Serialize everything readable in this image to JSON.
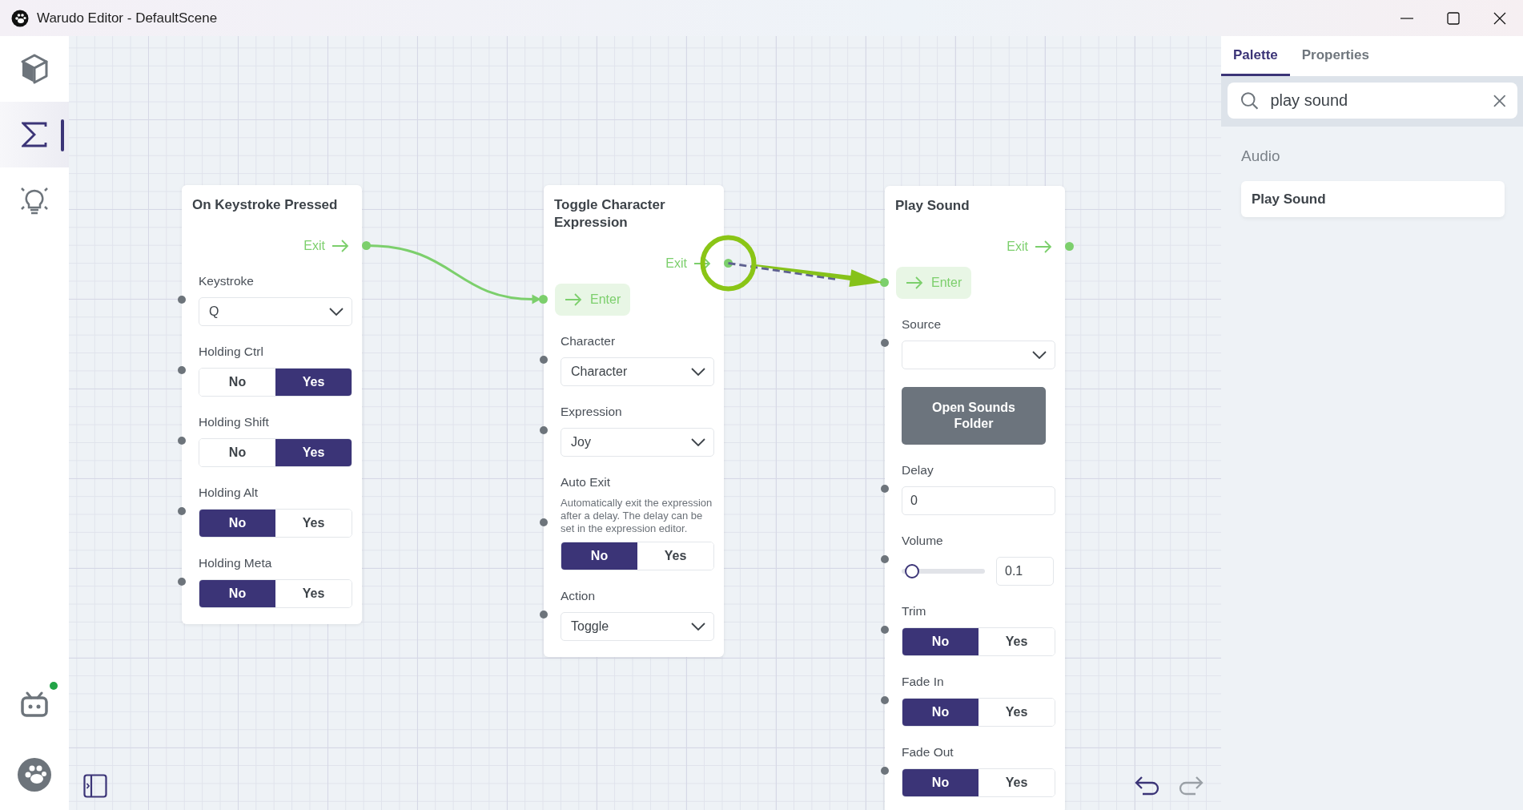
{
  "window": {
    "title": "Warudo Editor - DefaultScene"
  },
  "sidebar": {
    "items": [
      {
        "kind": "cube",
        "selected": false
      },
      {
        "kind": "sigma",
        "selected": true
      },
      {
        "kind": "bulb",
        "selected": false
      }
    ],
    "bottom_items": [
      {
        "kind": "bot",
        "notification": true
      },
      {
        "kind": "logo"
      }
    ]
  },
  "canvas": {
    "nodes": [
      {
        "title": "On Keystroke Pressed",
        "exit": "Exit",
        "fields": [
          {
            "kind": "dropdown",
            "label": "Keystroke",
            "value": "Q"
          },
          {
            "kind": "toggle",
            "label": "Holding Ctrl",
            "options": [
              {
                "label": "No",
                "selected": false
              },
              {
                "label": "Yes",
                "selected": true
              }
            ]
          },
          {
            "kind": "toggle",
            "label": "Holding Shift",
            "options": [
              {
                "label": "No",
                "selected": false
              },
              {
                "label": "Yes",
                "selected": true
              }
            ]
          },
          {
            "kind": "toggle",
            "label": "Holding Alt",
            "options": [
              {
                "label": "No",
                "selected": true
              },
              {
                "label": "Yes",
                "selected": false
              }
            ]
          },
          {
            "kind": "toggle",
            "label": "Holding Meta",
            "options": [
              {
                "label": "No",
                "selected": true
              },
              {
                "label": "Yes",
                "selected": false
              }
            ]
          }
        ]
      },
      {
        "title": "Toggle Character Expression",
        "exit": "Exit",
        "enter": "Enter",
        "fields": [
          {
            "kind": "dropdown",
            "label": "Character",
            "value": "Character"
          },
          {
            "kind": "dropdown",
            "label": "Expression",
            "value": "Joy"
          },
          {
            "kind": "toggle",
            "label": "Auto Exit",
            "description": "Automatically exit the expression after a delay. The delay can be set in the expression editor.",
            "options": [
              {
                "label": "No",
                "selected": true
              },
              {
                "label": "Yes",
                "selected": false
              }
            ]
          },
          {
            "kind": "dropdown",
            "label": "Action",
            "value": "Toggle"
          }
        ]
      },
      {
        "title": "Play Sound",
        "exit": "Exit",
        "enter": "Enter",
        "fields": [
          {
            "kind": "dropdown",
            "label": "Source"
          },
          {
            "kind": "button",
            "text": "Open Sounds Folder"
          },
          {
            "kind": "text",
            "label": "Delay",
            "value": "0"
          },
          {
            "kind": "slider",
            "label": "Volume",
            "level": 0.05,
            "value": "0.1"
          },
          {
            "kind": "toggle",
            "label": "Trim",
            "options": [
              {
                "label": "No",
                "selected": true
              },
              {
                "label": "Yes",
                "selected": false
              }
            ]
          },
          {
            "kind": "toggle",
            "label": "Fade In",
            "options": [
              {
                "label": "No",
                "selected": true
              },
              {
                "label": "Yes",
                "selected": false
              }
            ]
          },
          {
            "kind": "toggle",
            "label": "Fade Out",
            "options": [
              {
                "label": "No",
                "selected": true
              },
              {
                "label": "Yes",
                "selected": false
              }
            ]
          }
        ]
      }
    ],
    "undo": {
      "disabled": false
    },
    "redo": {
      "disabled": true
    }
  },
  "panel": {
    "tabs": [
      {
        "label": "Palette",
        "selected": true
      },
      {
        "label": "Properties",
        "selected": false
      }
    ],
    "search": {
      "value": "play sound"
    },
    "groups": [
      {
        "title": "Audio",
        "items": [
          "Play Sound"
        ]
      }
    ]
  }
}
